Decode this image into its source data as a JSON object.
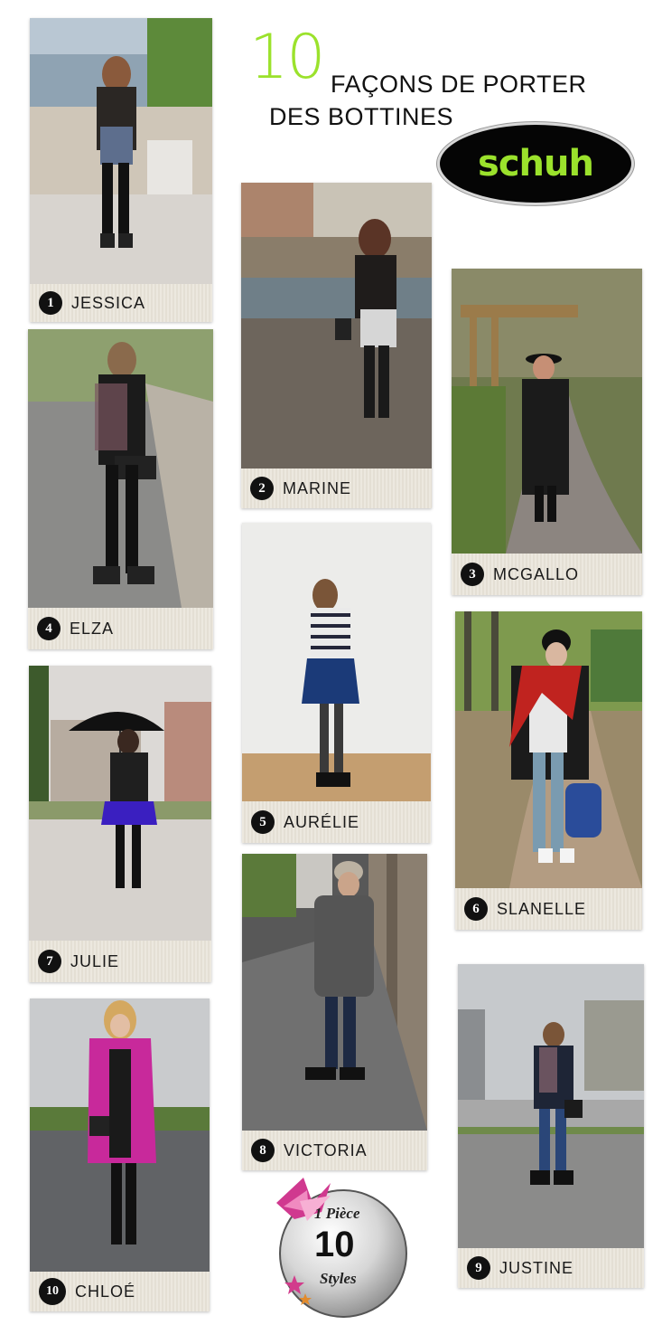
{
  "header": {
    "big_number": "10",
    "line1": "FAÇONS DE PORTER",
    "line2": "DES BOTTINES",
    "brand_logo_text": "schuh",
    "brand_color": "#9be22c"
  },
  "cards": [
    {
      "num": "1",
      "name": "JESSICA"
    },
    {
      "num": "2",
      "name": "MARINE"
    },
    {
      "num": "3",
      "name": "MCGALLO"
    },
    {
      "num": "4",
      "name": "ELZA"
    },
    {
      "num": "5",
      "name": "AURÉLIE"
    },
    {
      "num": "6",
      "name": "SLANELLE"
    },
    {
      "num": "7",
      "name": "JULIE"
    },
    {
      "num": "8",
      "name": "VICTORIA"
    },
    {
      "num": "9",
      "name": "JUSTINE"
    },
    {
      "num": "10",
      "name": "CHLOÉ"
    }
  ],
  "badge": {
    "line1": "1 Pièce",
    "line2": "10",
    "line3": "Styles"
  }
}
